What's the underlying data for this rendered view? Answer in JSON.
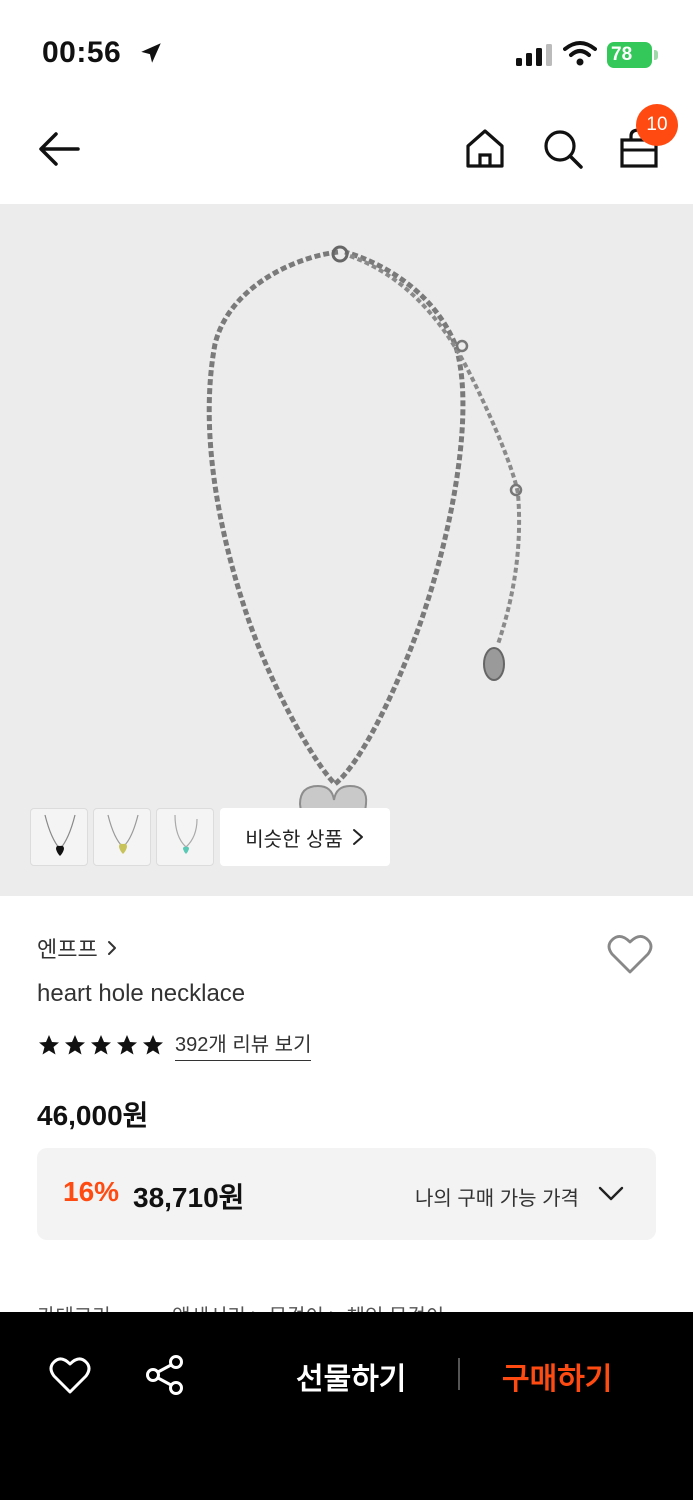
{
  "status_bar": {
    "time": "00:56",
    "battery": "78",
    "icons": [
      "location-arrow-icon",
      "cellular-signal-icon",
      "wifi-icon",
      "battery-icon"
    ]
  },
  "nav": {
    "back_icon": "arrow-left-icon",
    "home_icon": "home-icon",
    "search_icon": "search-icon",
    "cart_icon": "shopping-bag-icon",
    "cart_count": "10"
  },
  "gallery": {
    "thumbnails": [
      "black-heart-necklace",
      "yellow-heart-necklace",
      "mint-heart-necklace"
    ],
    "similar_label": "비슷한 상품"
  },
  "product": {
    "brand": "엔프프",
    "name": "heart hole necklace",
    "rating_stars": 5,
    "review_link": "392개 리뷰 보기",
    "price": "46,000원",
    "discount_pct": "16%",
    "discount_price": "38,710원",
    "my_price_label": "나의 구매 가능 가격",
    "category_label": "카테고리",
    "category_path": "액세서리 > 목걸이 > 체인 목걸이"
  },
  "bottom_bar": {
    "wish_icon": "heart-outline-icon",
    "share_icon": "share-icon",
    "gift_label": "선물하기",
    "buy_label": "구매하기"
  },
  "colors": {
    "accent": "#ff4b12",
    "battery": "#34c759",
    "image_bg": "#ececec",
    "bottom_bar": "#000000"
  }
}
